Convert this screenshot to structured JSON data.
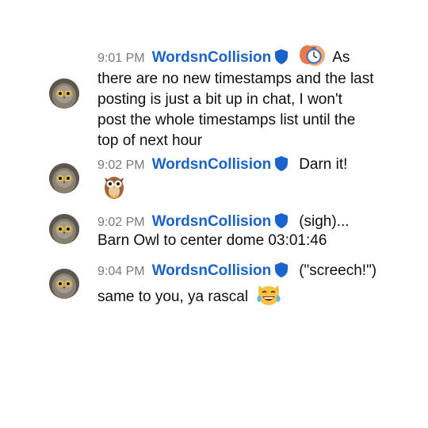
{
  "messages": [
    {
      "time": "9:01 PM",
      "author": "WordsnCollision",
      "first_line_text": "As",
      "text": "there are no new timestamps and the last posting is just a bit up in chat, I won't post the whole timestamps list until the top of next hour",
      "emoji_icon": "timer-clock-emoji"
    },
    {
      "time": "9:02 PM",
      "author": "WordsnCollision",
      "first_line_text": "Darn it!",
      "emoji_icon": "owl-emoji"
    },
    {
      "time": "9:02 PM",
      "author": "WordsnCollision",
      "first_line_text": "(sigh)...",
      "text": "Barn Owl to center dome 03:01:46"
    },
    {
      "time": "9:04 PM",
      "author": "WordsnCollision",
      "first_line_text": "(\"screech!\")",
      "text": "same to you, ya rascal",
      "emoji_icon": "laughing-cat-emoji"
    }
  ],
  "colors": {
    "author": "#1a62cc",
    "timestamp": "#7a7a7a",
    "verified_badge": "#1a62cc"
  }
}
